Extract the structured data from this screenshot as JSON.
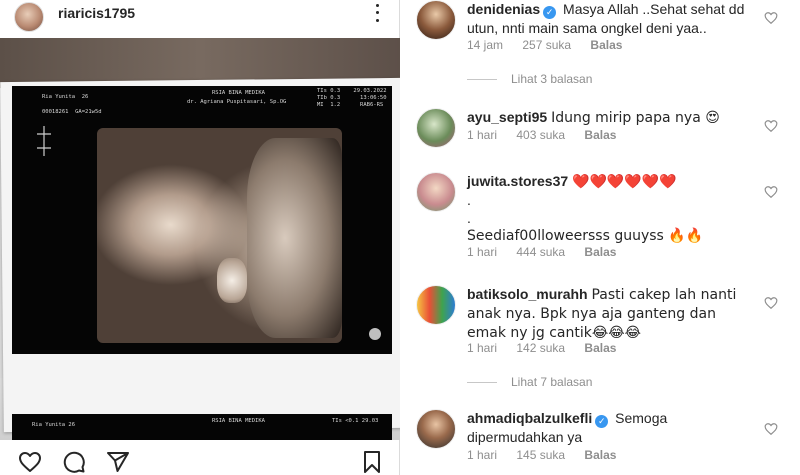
{
  "post": {
    "username": "riaricis1795",
    "icons": {
      "avatar": "profile-photo",
      "more": "more-options-icon",
      "like": "heart-icon",
      "comment": "comment-icon",
      "share": "share-icon",
      "save": "bookmark-icon"
    },
    "scan_text": {
      "header_left": "Ria Yunita  26",
      "header_id": "00018261  GA=21w5d",
      "header_center": "RSIA BINA MEDIKA",
      "header_doctor": "dr. Agriana Puspitasari, Sp.OG",
      "header_right_1": "TIs 0.3    29.03.2022",
      "header_right_2": "TIb 0.3      13:06:50",
      "header_right_3": "MI  1.2      RAB6-RS",
      "footer_left": "Ria Yunita  26",
      "footer_center": "RSIA BINA MEDIKA",
      "footer_right": "TIs <0.1     29.03"
    }
  },
  "comments": [
    {
      "username": "denidenias",
      "verified": true,
      "text": "Masya Allah ..Sehat sehat dd utun, nnti main sama ongkel deni yaa..",
      "time": "14 jam",
      "likes": "257 suka",
      "reply": "Balas"
    },
    {
      "view_replies": "Lihat 3 balasan"
    },
    {
      "username": "ayu_septi95",
      "verified": false,
      "text": "Idung mirip papa nya 😍",
      "time": "1 hari",
      "likes": "403 suka",
      "reply": "Balas"
    },
    {
      "username": "juwita.stores37",
      "verified": false,
      "text": "❤️❤️❤️❤️❤️❤️",
      "text_line2": ".",
      "text_line3": ".",
      "text_line4": "Seediaf00lloweersss guuyss 🔥🔥",
      "time": "1 hari",
      "likes": "444 suka",
      "reply": "Balas"
    },
    {
      "username": "batiksolo_murahh",
      "verified": false,
      "text": "Pasti cakep lah nanti anak nya. Bpk nya aja ganteng dan emak ny jg cantik😂😂😂",
      "time": "1 hari",
      "likes": "142 suka",
      "reply": "Balas"
    },
    {
      "view_replies": "Lihat 7 balasan"
    },
    {
      "username": "ahmadiqbalzulkefli",
      "verified": true,
      "text": "Semoga dipermudahkan ya",
      "time": "1 hari",
      "likes": "145 suka",
      "reply": "Balas"
    }
  ],
  "colors": {
    "text": "#262626",
    "muted": "#8e8e8e",
    "verified": "#3897f0",
    "divider": "#dbdbdb"
  }
}
